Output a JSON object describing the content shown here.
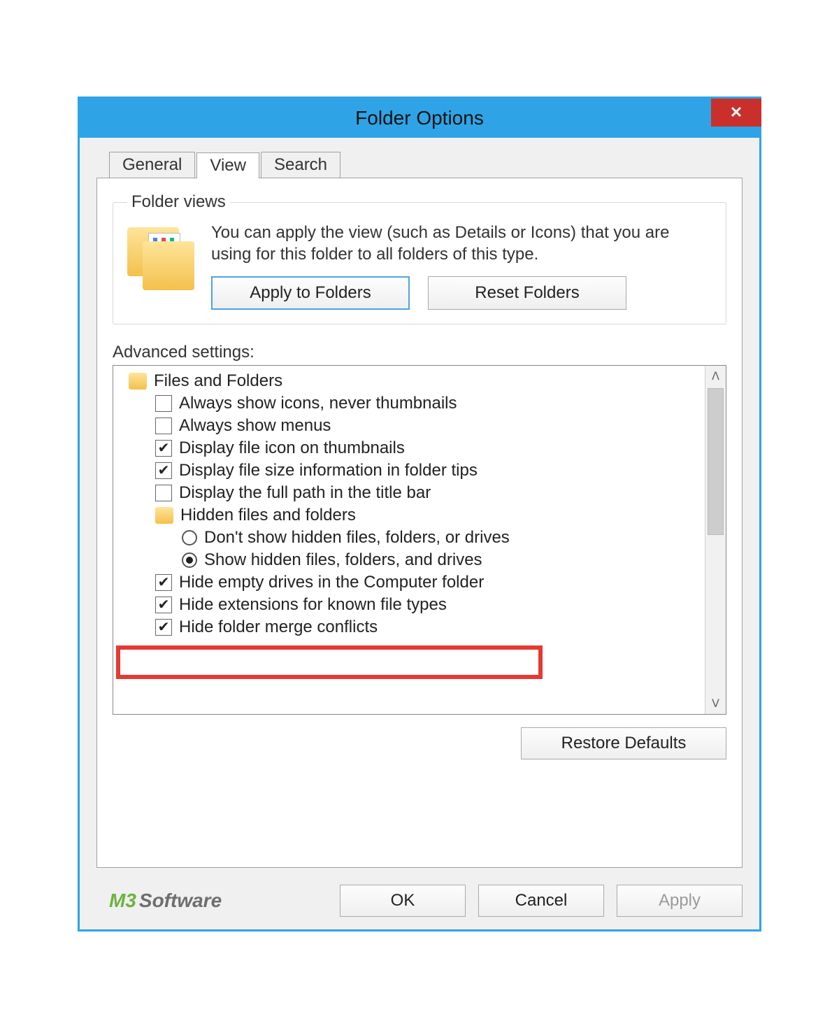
{
  "window": {
    "title": "Folder Options",
    "close_glyph": "✕"
  },
  "tabs": {
    "general": "General",
    "view": "View",
    "search": "Search"
  },
  "folder_views": {
    "legend": "Folder views",
    "description": "You can apply the view (such as Details or Icons) that you are using for this folder to all folders of this type.",
    "apply_btn": "Apply to Folders",
    "reset_btn": "Reset Folders"
  },
  "advanced": {
    "label": "Advanced settings:",
    "root": "Files and Folders",
    "items": {
      "always_icons": "Always show icons, never thumbnails",
      "always_menus": "Always show menus",
      "display_file_icon": "Display file icon on thumbnails",
      "display_file_size": "Display file size information in folder tips",
      "display_full_path": "Display the full path in the title bar",
      "hidden_group": "Hidden files and folders",
      "hidden_dont_show": "Don't show hidden files, folders, or drives",
      "hidden_show": "Show hidden files, folders, and drives",
      "hide_empty_drives": "Hide empty drives in the Computer folder",
      "hide_extensions": "Hide extensions for known file types",
      "hide_merge_conflicts": "Hide folder merge conflicts"
    },
    "restore_btn": "Restore Defaults"
  },
  "footer": {
    "brand_m3": "M3",
    "brand_soft": "Software",
    "ok": "OK",
    "cancel": "Cancel",
    "apply": "Apply"
  },
  "scroll": {
    "up": "ᐱ",
    "down": "ᐯ"
  }
}
